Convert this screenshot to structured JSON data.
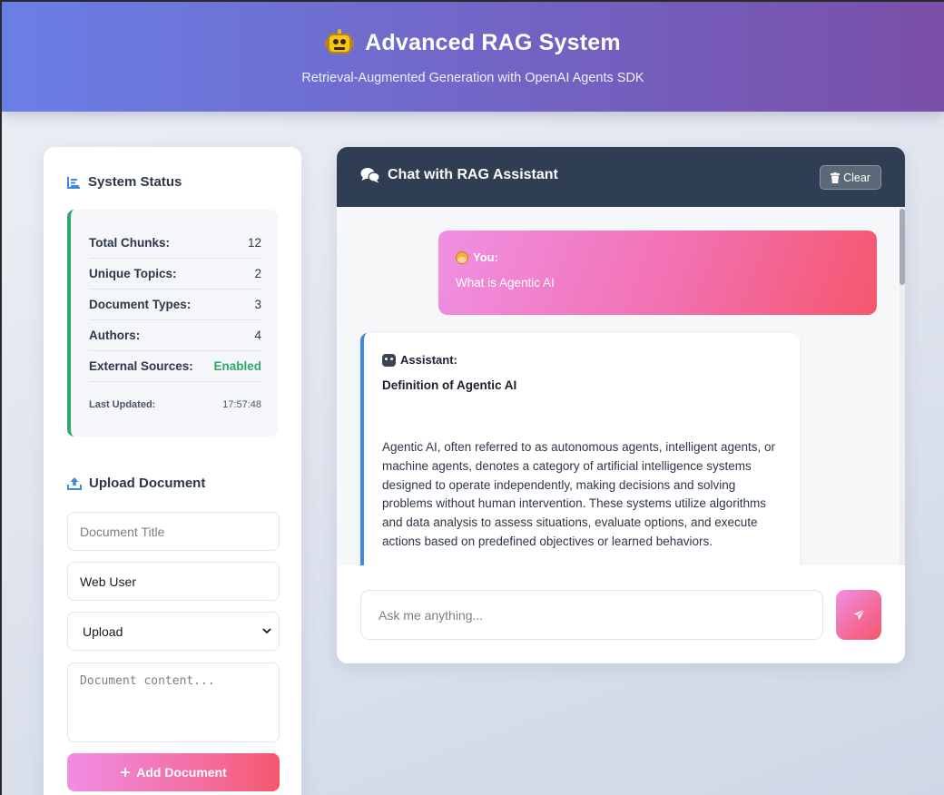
{
  "header": {
    "title": "Advanced RAG System",
    "subtitle": "Retrieval-Augmented Generation with OpenAI Agents SDK"
  },
  "sidebar": {
    "status_title": "System Status",
    "stats": [
      {
        "label": "Total Chunks:",
        "value": "12"
      },
      {
        "label": "Unique Topics:",
        "value": "2"
      },
      {
        "label": "Document Types:",
        "value": "3"
      },
      {
        "label": "Authors:",
        "value": "4"
      },
      {
        "label": "External Sources:",
        "value": "Enabled"
      }
    ],
    "last_updated_label": "Last Updated:",
    "last_updated_value": "17:57:48",
    "upload_title": "Upload Document",
    "title_placeholder": "Document Title",
    "author_value": "Web User",
    "type_selected": "Upload",
    "content_placeholder": "Document content...",
    "add_button_label": "Add Document"
  },
  "chat": {
    "title": "Chat with RAG Assistant",
    "clear_label": "Clear",
    "messages": [
      {
        "role": "user",
        "who": "You:",
        "text": "What is Agentic AI"
      },
      {
        "role": "assistant",
        "who": "Assistant:",
        "heading": "Definition of Agentic AI",
        "text": "Agentic AI, often referred to as autonomous agents, intelligent agents, or machine agents, denotes a category of artificial intelligence systems designed to operate independently, making decisions and solving problems without human intervention. These systems utilize algorithms and data analysis to assess situations, evaluate options, and execute actions based on predefined objectives or learned behaviors."
      }
    ],
    "input_placeholder": "Ask me anything..."
  },
  "colors": {
    "header_gradient_start": "#6a7fe6",
    "header_gradient_end": "#7a4fa8",
    "accent_pink": "#f5576c",
    "status_green": "#2fa86a",
    "chat_header": "#2f3e52",
    "assistant_border": "#3d8bd8"
  },
  "icons": {
    "header": "robot-icon",
    "status": "chart-bar-icon",
    "upload": "upload-icon",
    "chat": "comments-icon",
    "clear": "trash-icon",
    "add": "plus-icon",
    "send": "paper-plane-icon"
  }
}
